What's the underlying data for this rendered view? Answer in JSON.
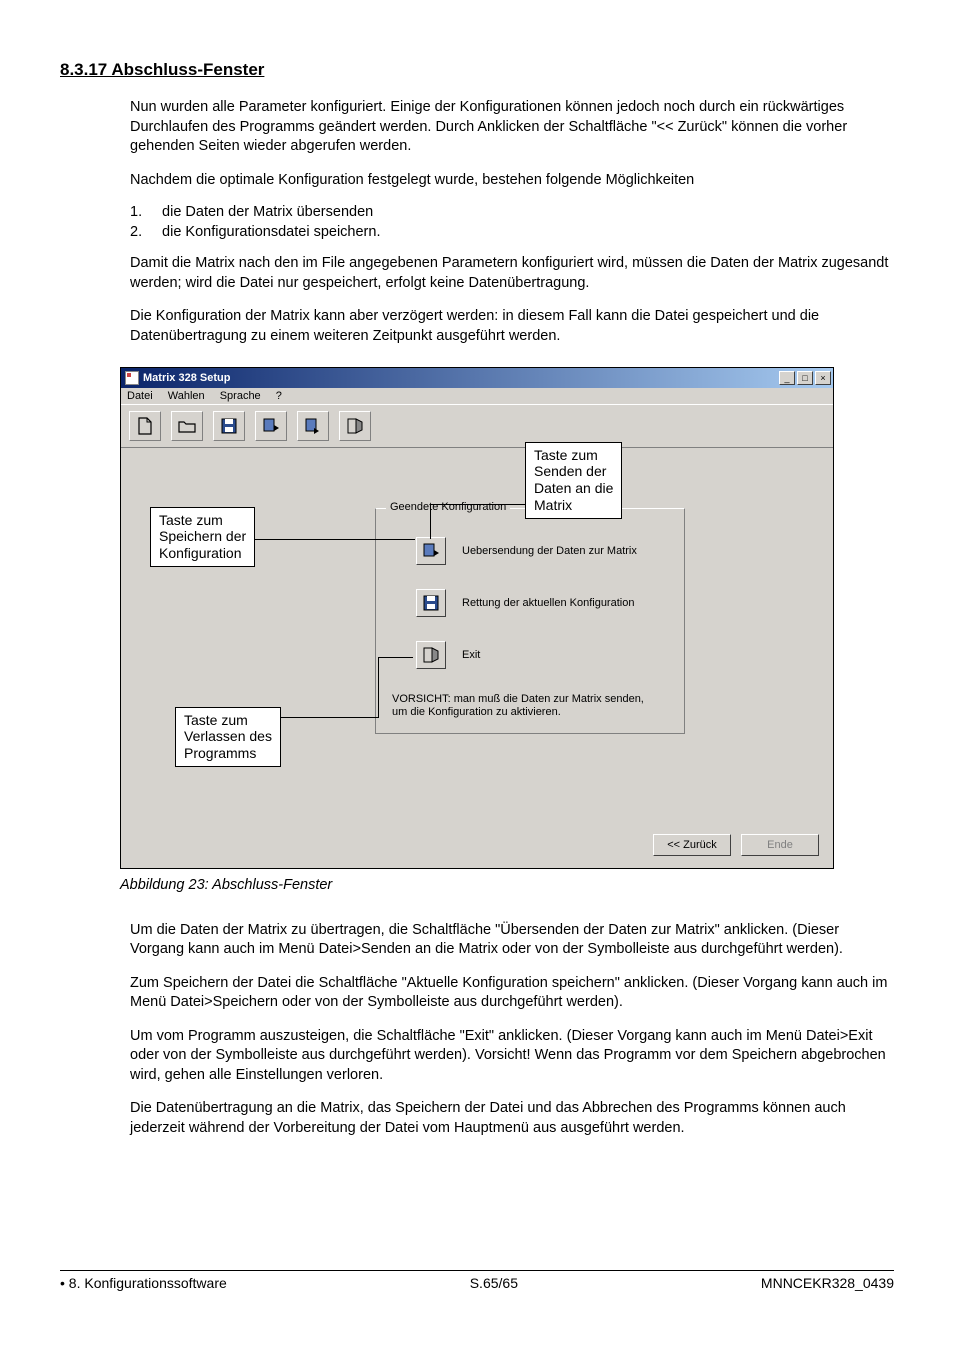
{
  "heading": "8.3.17  Abschluss-Fenster",
  "para1": "Nun wurden alle Parameter konfiguriert. Einige der Konfigurationen können jedoch noch durch ein rückwärtiges Durchlaufen des Programms geändert werden. Durch Anklicken der Schaltfläche \"<< Zurück\" können die vorher gehenden Seiten wieder abgerufen werden.",
  "para2": "Nachdem die optimale Konfiguration festgelegt wurde, bestehen folgende Möglichkeiten",
  "list": [
    {
      "num": "1.",
      "text": "die Daten der Matrix übersenden"
    },
    {
      "num": "2.",
      "text": "die Konfigurationsdatei speichern."
    }
  ],
  "para3": "Damit die Matrix nach den im File angegebenen Parametern konfiguriert wird, müssen die Daten der Matrix zugesandt werden; wird die Datei nur gespeichert, erfolgt keine Datenübertragung.",
  "para4": "Die Konfiguration der Matrix kann aber verzögert werden: in diesem Fall kann die Datei gespeichert und die Datenübertragung zu einem weiteren Zeitpunkt ausgeführt werden.",
  "app": {
    "title": "Matrix 328 Setup",
    "menu": {
      "file": "Datei",
      "select": "Wahlen",
      "lang": "Sprache",
      "help": "?"
    },
    "fieldset_legend": "Geendete Konfiguration",
    "actions": {
      "send": "Uebersendung der Daten zur Matrix",
      "save": "Rettung der aktuellen Konfiguration",
      "exit": "Exit"
    },
    "warning_line1": "VORSICHT: man muß die Daten zur Matrix senden,",
    "warning_line2": "um die Konfiguration zu aktivieren.",
    "nav": {
      "back": "<< Zurück",
      "end": "Ende"
    }
  },
  "callouts": {
    "save": "Taste zum\nSpeichern der\nKonfiguration",
    "send": "Taste zum\nSenden der\nDaten an die\nMatrix",
    "exit": "Taste zum\nVerlassen des\nProgramms"
  },
  "figure_caption": "Abbildung 23: Abschluss-Fenster",
  "para5": "Um die Daten der Matrix zu übertragen, die Schaltfläche \"Übersenden der Daten zur Matrix\" anklicken. (Dieser Vorgang kann auch im Menü Datei>Senden an die Matrix oder von der Symbolleiste aus durchgeführt werden).",
  "para6": "Zum Speichern der Datei die Schaltfläche \"Aktuelle Konfiguration speichern\" anklicken. (Dieser Vorgang kann auch im Menü Datei>Speichern oder von der Symbolleiste aus durchgeführt werden).",
  "para7": "Um vom Programm auszusteigen, die Schaltfläche \"Exit\" anklicken. (Dieser Vorgang kann auch im Menü Datei>Exit oder von der Symbolleiste aus durchgeführt werden). Vorsicht! Wenn das Programm vor dem Speichern abgebrochen wird, gehen alle Einstellungen verloren.",
  "para8": "Die Datenübertragung an die Matrix, das Speichern der Datei und das Abbrechen des Programms können auch jederzeit während der Vorbereitung der Datei vom Hauptmenü aus ausgeführt werden.",
  "footer": {
    "left": "•   8. Konfigurationssoftware",
    "center": "S.65/65",
    "right": "MNNCEKR328_0439"
  }
}
